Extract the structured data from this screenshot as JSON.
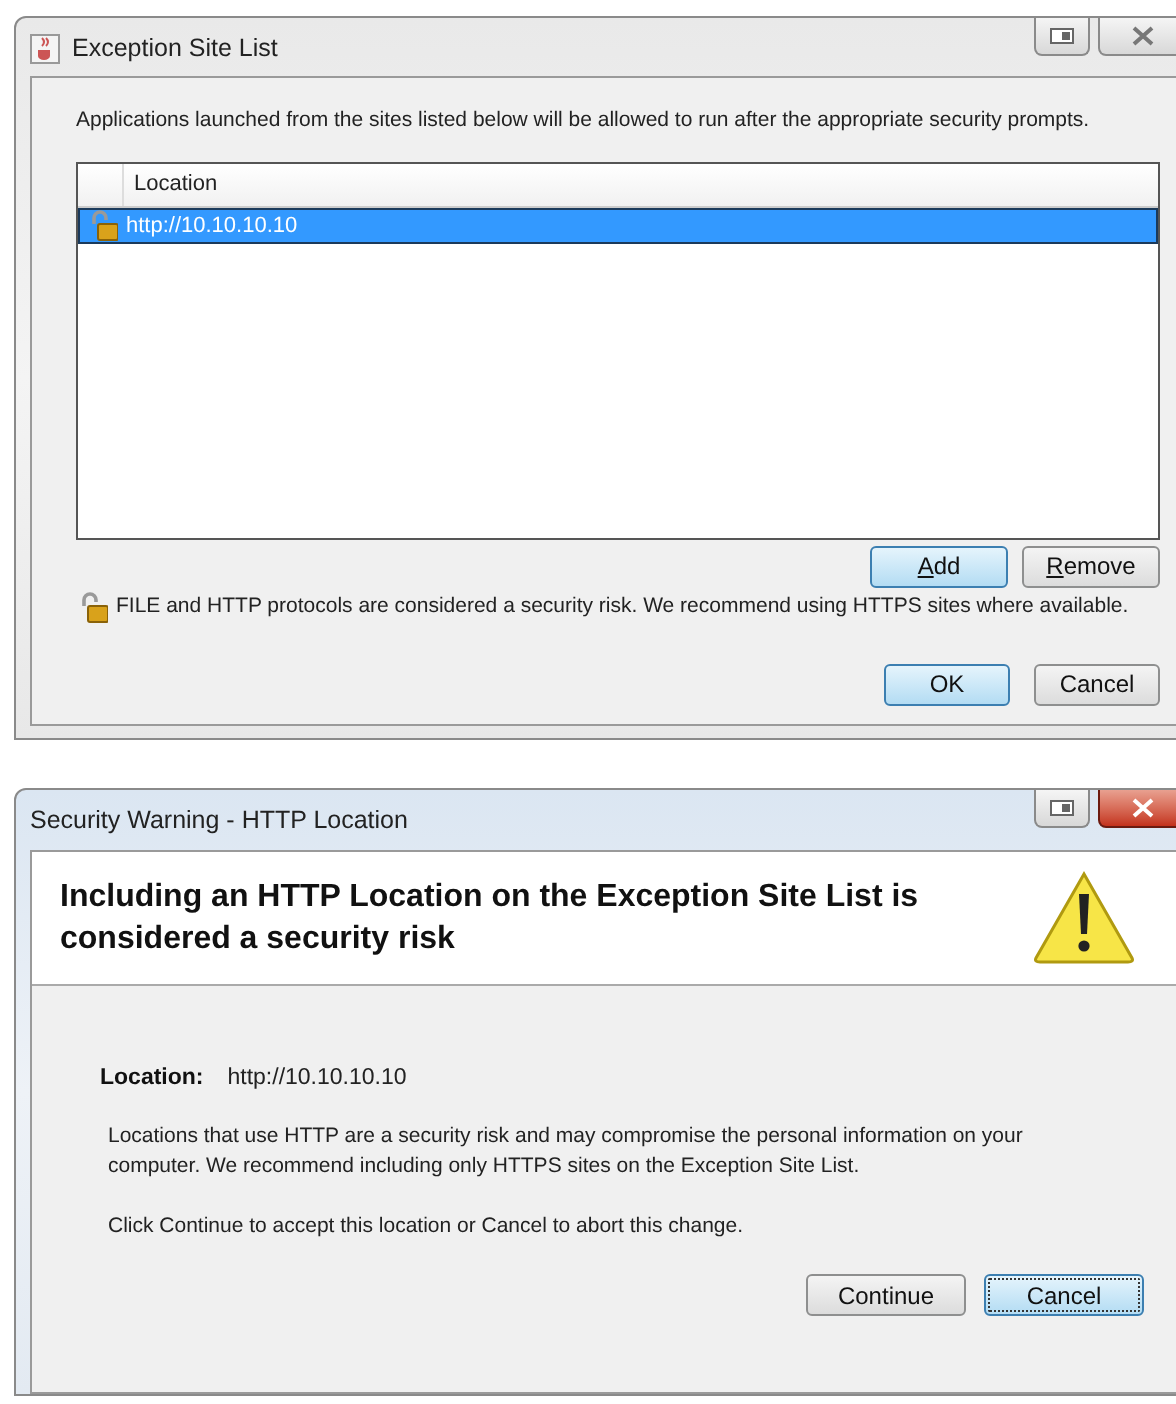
{
  "exception_site_list_window": {
    "title": "Exception Site List",
    "active": false,
    "intro": "Applications launched from the sites listed below will be allowed to run after the appropriate security prompts.",
    "table": {
      "columns": [
        "Location"
      ],
      "rows": [
        {
          "location": "http://10.10.10.10",
          "selected": true
        }
      ]
    },
    "list_buttons": [
      {
        "label": "Add",
        "first_letter_underlined": true,
        "default": true
      },
      {
        "label": "Remove",
        "first_letter_underlined": true,
        "default": false
      }
    ],
    "note": "FILE and HTTP protocols are considered a security risk.  We recommend using HTTPS sites where available.",
    "buttons": [
      {
        "label": "OK",
        "default": true
      },
      {
        "label": "Cancel",
        "default": false
      }
    ]
  },
  "security_warning_window": {
    "title": "Security Warning - HTTP Location",
    "active": true,
    "heading": "Including an HTTP Location on the Exception Site List is considered a security risk",
    "location_label": "Location:",
    "location_value": "http://10.10.10.10",
    "paragraphs": [
      "Locations that use HTTP are a security risk and may compromise the personal information on your computer.  We recommend including only HTTPS sites on the Exception Site List.",
      "Click Continue to accept this location or Cancel to abort this change."
    ],
    "buttons": [
      {
        "label": "Continue",
        "default": false,
        "focused": false
      },
      {
        "label": "Cancel",
        "default": true,
        "focused": true
      }
    ]
  }
}
